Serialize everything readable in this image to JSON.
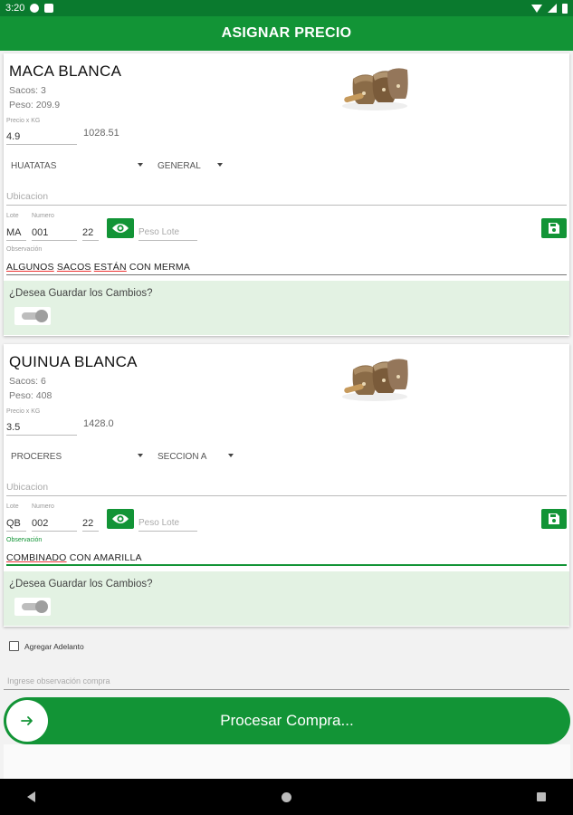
{
  "status_bar": {
    "time": "3:20"
  },
  "app_bar": {
    "title": "ASIGNAR PRECIO"
  },
  "products": [
    {
      "name": "MACA BLANCA",
      "sacos": "Sacos: 3",
      "peso": "Peso: 209.9",
      "precio_label": "Precio x KG",
      "precio_value": "4.9",
      "total": "1028.51",
      "dropdown1": "HUATATAS",
      "dropdown2": "GENERAL",
      "ubicacion_placeholder": "Ubicacion",
      "lote_label": "Lote",
      "numero_label": "Numero",
      "lote_value": "MA",
      "numero_value": "001",
      "extra_value": "22",
      "peso_lote_placeholder": "Peso Lote",
      "observacion_label": "Observación",
      "observacion_words": [
        "ALGUNOS",
        "SACOS",
        "ESTÁN",
        "CON MERMA"
      ],
      "confirm_text": "¿Desea Guardar los Cambios?"
    },
    {
      "name": "QUINUA BLANCA",
      "sacos": "Sacos: 6",
      "peso": "Peso: 408",
      "precio_label": "Precio x KG",
      "precio_value": "3.5",
      "total": "1428.0",
      "dropdown1": "PROCERES",
      "dropdown2": "SECCION A",
      "ubicacion_placeholder": "Ubicacion",
      "lote_label": "Lote",
      "numero_label": "Numero",
      "lote_value": "QB",
      "numero_value": "002",
      "extra_value": "22",
      "peso_lote_placeholder": "Peso Lote",
      "observacion_label": "Observación",
      "observacion_words": [
        "COMBINADO",
        "CON AMARILLA"
      ],
      "confirm_text": "¿Desea Guardar los Cambios?"
    }
  ],
  "adelanto": {
    "label": "Agregar Adelanto"
  },
  "observacion_compra": {
    "placeholder": "Ingrese observación compra"
  },
  "process_button": {
    "label": "Procesar Compra..."
  },
  "colors": {
    "primary": "#129436",
    "status_bar": "#0a7a2e",
    "confirm_bg": "#e3f2e3"
  }
}
